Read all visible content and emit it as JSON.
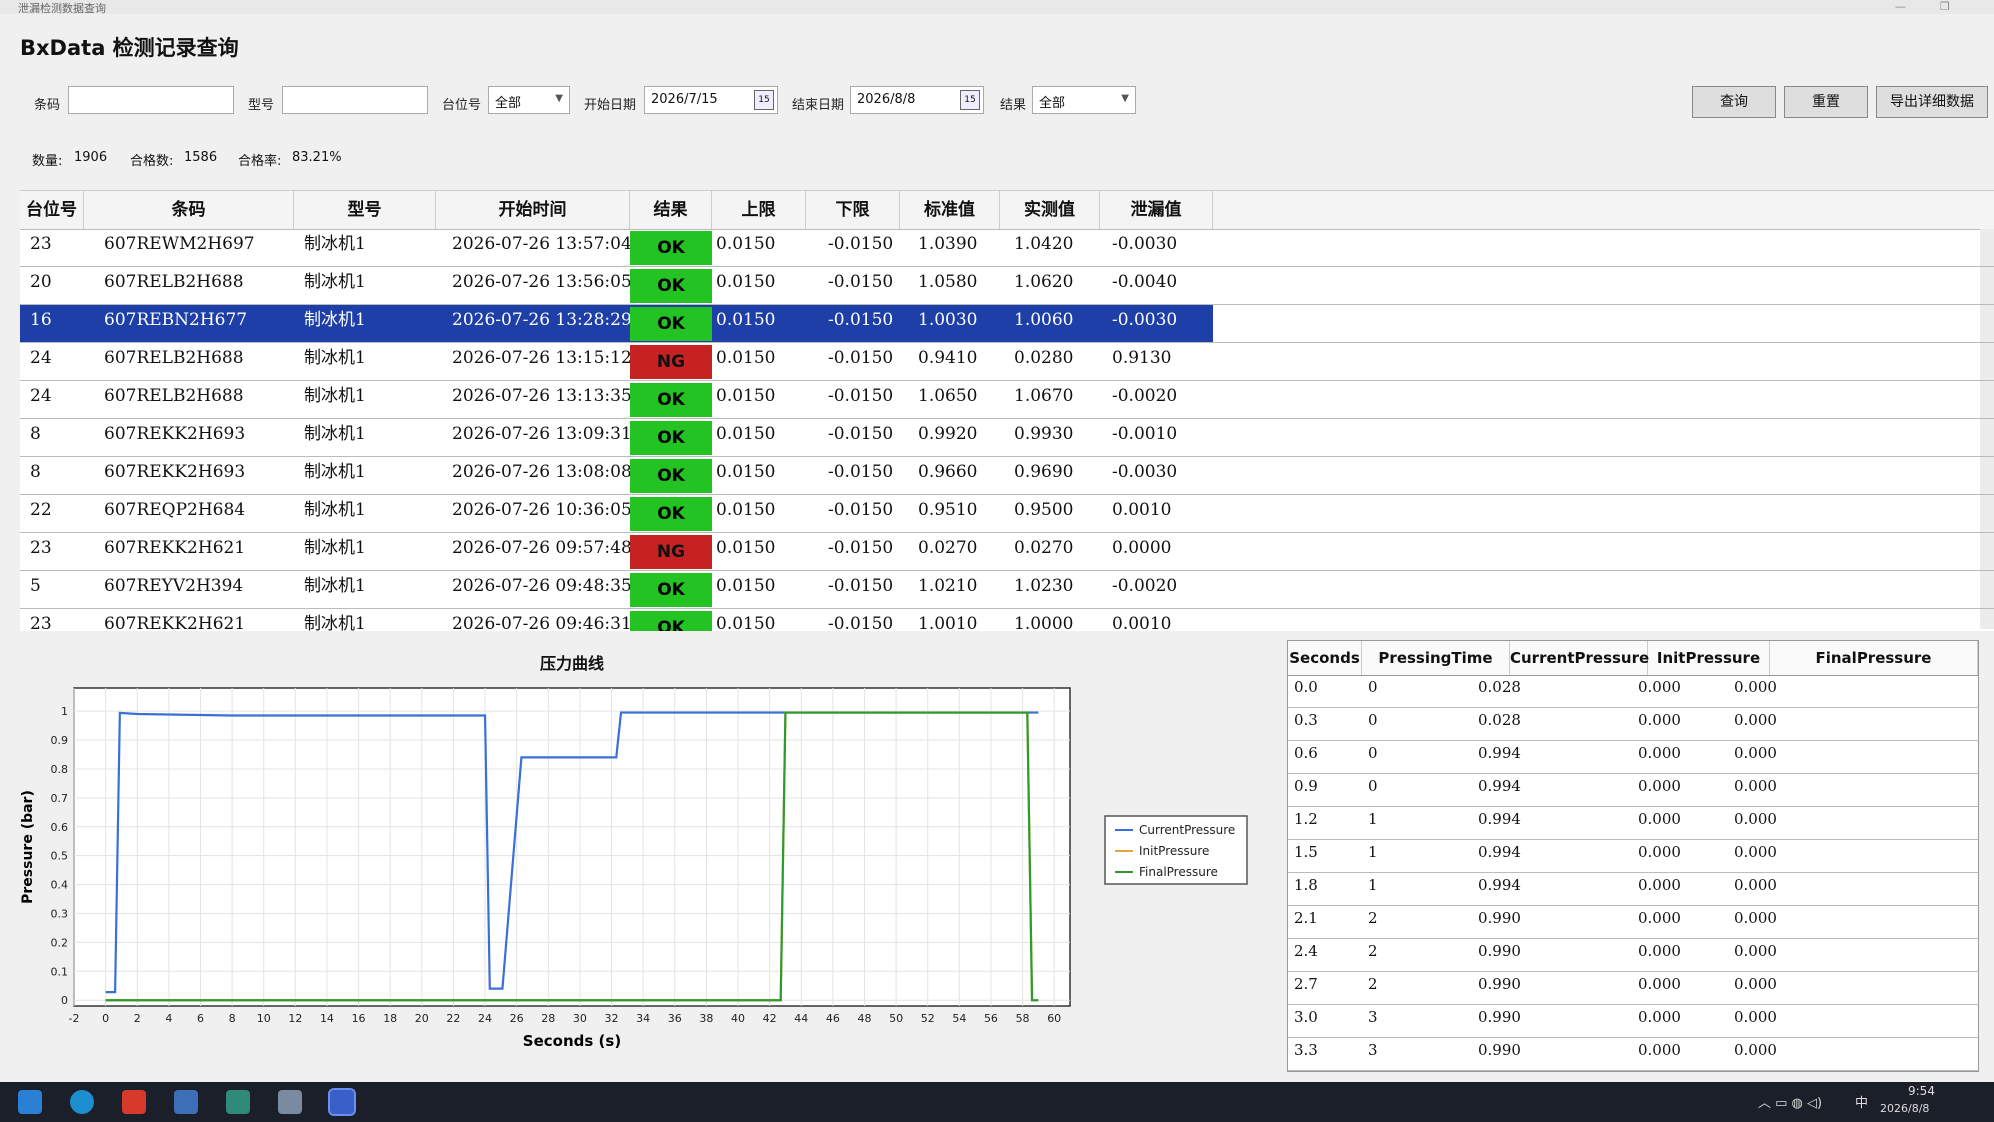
{
  "window": {
    "title": "泄漏检测数据查询"
  },
  "app_title": "BxData 检测记录查询",
  "filters": {
    "barcode_label": "条码",
    "barcode_value": "",
    "model_label": "型号",
    "model_value": "",
    "station_label": "台位号",
    "station_value": "全部",
    "start_label": "开始日期",
    "start_value": "2026/7/15",
    "end_label": "结束日期",
    "end_value": "2026/8/8",
    "result_label": "结果",
    "result_value": "全部",
    "calendar_icon": "calendar-icon"
  },
  "buttons": {
    "query": "查询",
    "reset": "重置",
    "export": "导出详细数据"
  },
  "stats": {
    "count_label": "数量:",
    "count": "1906",
    "pass_label": "合格数:",
    "pass": "1586",
    "rate_label": "合格率:",
    "rate": "83.21%"
  },
  "grid": {
    "columns": [
      "台位号",
      "条码",
      "型号",
      "开始时间",
      "结果",
      "上限",
      "下限",
      "标准值",
      "实测值",
      "泄漏值"
    ],
    "selected_index": 2,
    "rows": [
      {
        "station": "23",
        "barcode": "607REWM2H697",
        "model": "制冰机1",
        "time": "2026-07-26 13:57:04",
        "result": "OK",
        "upper": "0.0150",
        "lower": "-0.0150",
        "std": "1.0390",
        "actual": "1.0420",
        "leak": "-0.0030"
      },
      {
        "station": "20",
        "barcode": "607RELB2H688",
        "model": "制冰机1",
        "time": "2026-07-26 13:56:05",
        "result": "OK",
        "upper": "0.0150",
        "lower": "-0.0150",
        "std": "1.0580",
        "actual": "1.0620",
        "leak": "-0.0040"
      },
      {
        "station": "16",
        "barcode": "607REBN2H677",
        "model": "制冰机1",
        "time": "2026-07-26 13:28:29",
        "result": "OK",
        "upper": "0.0150",
        "lower": "-0.0150",
        "std": "1.0030",
        "actual": "1.0060",
        "leak": "-0.0030"
      },
      {
        "station": "24",
        "barcode": "607RELB2H688",
        "model": "制冰机1",
        "time": "2026-07-26 13:15:12",
        "result": "NG",
        "upper": "0.0150",
        "lower": "-0.0150",
        "std": "0.9410",
        "actual": "0.0280",
        "leak": "0.9130"
      },
      {
        "station": "24",
        "barcode": "607RELB2H688",
        "model": "制冰机1",
        "time": "2026-07-26 13:13:35",
        "result": "OK",
        "upper": "0.0150",
        "lower": "-0.0150",
        "std": "1.0650",
        "actual": "1.0670",
        "leak": "-0.0020"
      },
      {
        "station": "8",
        "barcode": "607REKK2H693",
        "model": "制冰机1",
        "time": "2026-07-26 13:09:31",
        "result": "OK",
        "upper": "0.0150",
        "lower": "-0.0150",
        "std": "0.9920",
        "actual": "0.9930",
        "leak": "-0.0010"
      },
      {
        "station": "8",
        "barcode": "607REKK2H693",
        "model": "制冰机1",
        "time": "2026-07-26 13:08:08",
        "result": "OK",
        "upper": "0.0150",
        "lower": "-0.0150",
        "std": "0.9660",
        "actual": "0.9690",
        "leak": "-0.0030"
      },
      {
        "station": "22",
        "barcode": "607REQP2H684",
        "model": "制冰机1",
        "time": "2026-07-26 10:36:05",
        "result": "OK",
        "upper": "0.0150",
        "lower": "-0.0150",
        "std": "0.9510",
        "actual": "0.9500",
        "leak": "0.0010"
      },
      {
        "station": "23",
        "barcode": "607REKK2H621",
        "model": "制冰机1",
        "time": "2026-07-26 09:57:48",
        "result": "NG",
        "upper": "0.0150",
        "lower": "-0.0150",
        "std": "0.0270",
        "actual": "0.0270",
        "leak": "0.0000"
      },
      {
        "station": "5",
        "barcode": "607REYV2H394",
        "model": "制冰机1",
        "time": "2026-07-26 09:48:35",
        "result": "OK",
        "upper": "0.0150",
        "lower": "-0.0150",
        "std": "1.0210",
        "actual": "1.0230",
        "leak": "-0.0020"
      },
      {
        "station": "23",
        "barcode": "607REKK2H621",
        "model": "制冰机1",
        "time": "2026-07-26 09:46:31",
        "result": "OK",
        "upper": "0.0150",
        "lower": "-0.0150",
        "std": "1.0010",
        "actual": "1.0000",
        "leak": "0.0010"
      }
    ]
  },
  "chart_data": {
    "type": "line",
    "title": "压力曲线",
    "xlabel": "Seconds (s)",
    "ylabel": "Pressure (bar)",
    "xlim": [
      -2,
      61
    ],
    "ylim": [
      -0.02,
      1.08
    ],
    "xticks": [
      -2,
      0,
      2,
      4,
      6,
      8,
      10,
      12,
      14,
      16,
      18,
      20,
      22,
      24,
      26,
      28,
      30,
      32,
      34,
      36,
      38,
      40,
      42,
      44,
      46,
      48,
      50,
      52,
      54,
      56,
      58,
      60
    ],
    "yticks": [
      0,
      0.1,
      0.2,
      0.3,
      0.4,
      0.5,
      0.6,
      0.7,
      0.8,
      0.9,
      1
    ],
    "ytick_labels": [
      "0",
      "0.1",
      "0.2",
      "0.3",
      "0.4",
      "0.5",
      "0.6",
      "0.7",
      "0.8",
      "0.9",
      "1"
    ],
    "legend_position": "right",
    "grid": true,
    "series": [
      {
        "name": "CurrentPressure",
        "color": "#3a6fd8",
        "x": [
          0,
          0.6,
          0.9,
          2,
          8,
          24,
          24.3,
          25.1,
          26.3,
          26.7,
          32.3,
          32.6,
          34,
          58,
          59
        ],
        "y": [
          0.028,
          0.028,
          0.994,
          0.99,
          0.985,
          0.985,
          0.04,
          0.04,
          0.84,
          0.84,
          0.84,
          0.995,
          0.995,
          0.995,
          0.995
        ]
      },
      {
        "name": "InitPressure",
        "color": "#e8a23a",
        "x": [
          0,
          42.7,
          43.0,
          58.3,
          58.6
        ],
        "y": [
          0,
          0,
          0.995,
          0.995,
          0
        ]
      },
      {
        "name": "FinalPressure",
        "color": "#2e9b2e",
        "x": [
          0,
          42.7,
          43.0,
          58.3,
          58.6,
          59
        ],
        "y": [
          0,
          0,
          0.995,
          0.995,
          0,
          0
        ]
      }
    ]
  },
  "right_table": {
    "columns": [
      "Seconds",
      "PressingTime",
      "CurrentPressure",
      "InitPressure",
      "FinalPressure"
    ],
    "rows": [
      [
        "0.0",
        "0",
        "0.028",
        "0.000",
        "0.000"
      ],
      [
        "0.3",
        "0",
        "0.028",
        "0.000",
        "0.000"
      ],
      [
        "0.6",
        "0",
        "0.994",
        "0.000",
        "0.000"
      ],
      [
        "0.9",
        "0",
        "0.994",
        "0.000",
        "0.000"
      ],
      [
        "1.2",
        "1",
        "0.994",
        "0.000",
        "0.000"
      ],
      [
        "1.5",
        "1",
        "0.994",
        "0.000",
        "0.000"
      ],
      [
        "1.8",
        "1",
        "0.994",
        "0.000",
        "0.000"
      ],
      [
        "2.1",
        "2",
        "0.990",
        "0.000",
        "0.000"
      ],
      [
        "2.4",
        "2",
        "0.990",
        "0.000",
        "0.000"
      ],
      [
        "2.7",
        "2",
        "0.990",
        "0.000",
        "0.000"
      ],
      [
        "3.0",
        "3",
        "0.990",
        "0.000",
        "0.000"
      ],
      [
        "3.3",
        "3",
        "0.990",
        "0.000",
        "0.000"
      ]
    ]
  },
  "taskbar": {
    "time": "9:54",
    "date": "2026/8/8",
    "ime": "中"
  }
}
